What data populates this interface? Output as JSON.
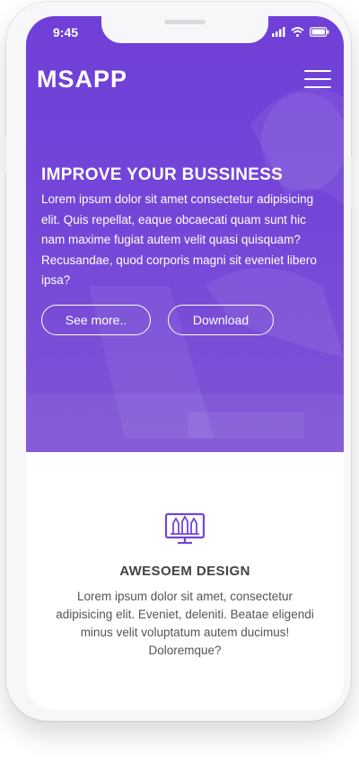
{
  "status_bar": {
    "time": "9:45"
  },
  "brand": {
    "logo": "MSAPP"
  },
  "hero": {
    "title": "IMPROVE YOUR BUSSINESS",
    "text": "Lorem ipsum dolor sit amet consectetur adipisicing elit. Quis repellat, eaque obcaecati quam sunt hic nam maxime fugiat autem velit quasi quisquam? Recusandae, quod corporis magni sit eveniet libero ipsa?",
    "see_more_label": "See more..",
    "download_label": "Download"
  },
  "feature": {
    "icon": "design-monitor-icon",
    "title": "AWESOEM DESIGN",
    "text": "Lorem ipsum dolor sit amet, consectetur adipisicing elit. Eveniet, deleniti. Beatae eligendi minus velit voluptatum autem ducimus! Doloremque?"
  },
  "colors": {
    "accent": "#7446d8",
    "hero_text": "#ffffff",
    "feature_title": "#444444",
    "feature_text": "#555555"
  }
}
